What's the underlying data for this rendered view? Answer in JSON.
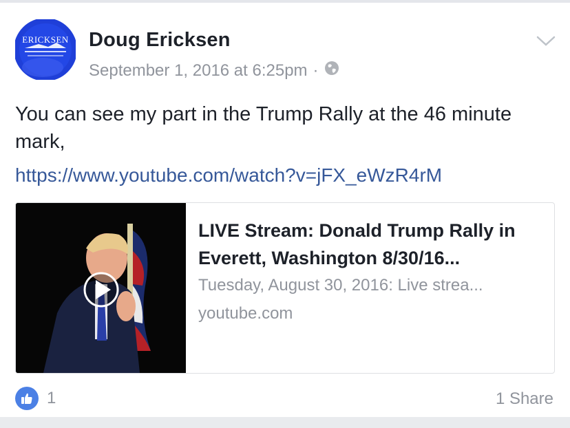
{
  "post": {
    "author": "Doug Ericksen",
    "timestamp": "September 1, 2016 at 6:25pm",
    "separator": "·",
    "privacy_icon": "globe-icon",
    "menu_icon": "chevron-down-icon",
    "text": "You can see my part in the Trump Rally at the 46 minute mark,",
    "link": "https://www.youtube.com/watch?v=jFX_eWzR4rM"
  },
  "avatar": {
    "logo_text": "ERICKSEN"
  },
  "preview": {
    "title": "LIVE Stream: Donald Trump Rally in Everett, Washington 8/30/16...",
    "description": "Tuesday, August 30, 2016: Live strea...",
    "domain": "youtube.com",
    "play_icon": "play-icon"
  },
  "footer": {
    "like_icon": "thumbs-up-icon",
    "like_count": "1",
    "share_count": "1 Share"
  },
  "colors": {
    "link": "#365899",
    "muted": "#90949c",
    "like_blue": "#4b80e5",
    "avatar_blue": "#1f3fd8"
  }
}
